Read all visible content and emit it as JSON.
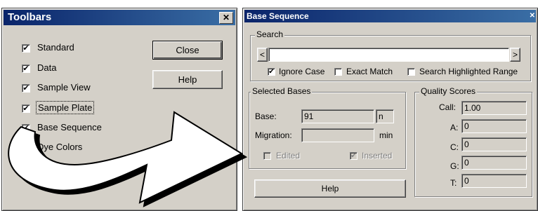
{
  "toolbars": {
    "title": "Toolbars",
    "close_x": "✕",
    "items": [
      {
        "label": "Standard",
        "checked": true
      },
      {
        "label": "Data",
        "checked": true
      },
      {
        "label": "Sample View",
        "checked": true
      },
      {
        "label": "Sample Plate",
        "checked": true
      },
      {
        "label": "Base Sequence",
        "checked": true
      },
      {
        "label": "Dye Colors",
        "checked": true
      }
    ],
    "close_button": "Close",
    "help_button": "Help"
  },
  "base_sequence": {
    "title": "Base Sequence",
    "close_x": "✕",
    "search": {
      "group_label": "Search",
      "input_value": "",
      "prev_arrow": "<",
      "next_arrow": ">",
      "options": [
        {
          "label": "Ignore Case",
          "checked": true
        },
        {
          "label": "Exact Match",
          "checked": false
        },
        {
          "label": "Search Highlighted Range",
          "checked": false
        }
      ]
    },
    "selected_bases": {
      "group_label": "Selected Bases",
      "base_label": "Base:",
      "base_value": "91",
      "base_unit": "n",
      "migration_label": "Migration:",
      "migration_value": "",
      "migration_unit": "min",
      "edited_label": "Edited",
      "edited_checked": false,
      "inserted_label": "Inserted",
      "inserted_checked": true
    },
    "quality_scores": {
      "group_label": "Quality Scores",
      "rows": [
        {
          "label": "Call:",
          "value": "1.00"
        },
        {
          "label": "A:",
          "value": "0"
        },
        {
          "label": "C:",
          "value": "0"
        },
        {
          "label": "G:",
          "value": "0"
        },
        {
          "label": "T:",
          "value": "0"
        }
      ]
    },
    "help_button": "Help"
  },
  "arrow": {
    "fill": "#ffffff",
    "stroke": "#000000",
    "shadow": "#000000"
  }
}
